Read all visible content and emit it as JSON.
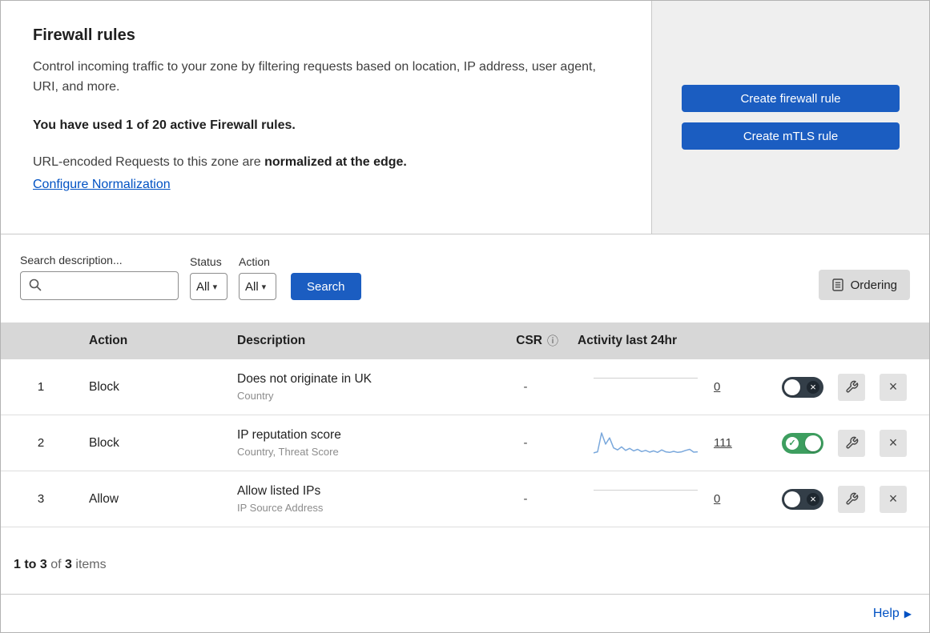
{
  "header": {
    "title": "Firewall rules",
    "description": "Control incoming traffic to your zone by filtering requests based on location, IP address, user agent, URI, and more.",
    "usage_notice": "You have used 1 of 20 active Firewall rules.",
    "normalization_text": "URL-encoded Requests to this zone are ",
    "normalization_bold": "normalized at the edge.",
    "normalization_link": "Configure Normalization",
    "create_firewall_rule_label": "Create firewall rule",
    "create_mtls_rule_label": "Create mTLS rule"
  },
  "filters": {
    "search_label": "Search description...",
    "status_label": "Status",
    "status_value": "All",
    "action_label": "Action",
    "action_value": "All",
    "search_button_label": "Search",
    "ordering_button_label": "Ordering"
  },
  "table": {
    "headers": {
      "action": "Action",
      "description": "Description",
      "csr": "CSR",
      "activity": "Activity last 24hr"
    },
    "rows": [
      {
        "number": "1",
        "action": "Block",
        "description": "Does not originate in UK",
        "match": "Country",
        "csr": "-",
        "activity_count": "0",
        "enabled": false
      },
      {
        "number": "2",
        "action": "Block",
        "description": "IP reputation score",
        "match": "Country, Threat Score",
        "csr": "-",
        "activity_count": "111",
        "enabled": true
      },
      {
        "number": "3",
        "action": "Allow",
        "description": "Allow listed IPs",
        "match": "IP Source Address",
        "csr": "-",
        "activity_count": "0",
        "enabled": false
      }
    ]
  },
  "chart_data": {
    "type": "line",
    "title": "Activity last 24hr sparkline (rule 2)",
    "values": [
      10,
      14,
      90,
      45,
      70,
      30,
      22,
      34,
      20,
      28,
      18,
      24,
      15,
      20,
      13,
      18,
      12,
      22,
      14,
      12,
      16,
      12,
      14,
      20,
      24,
      13,
      14
    ],
    "color": "#7aa8dc"
  },
  "footer": {
    "range": "1 to 3",
    "of_text": "of",
    "total": "3",
    "items_text": "items",
    "help_label": "Help"
  },
  "icons": {
    "search": "magnifier",
    "dropdown": "caret-down",
    "ordering": "list-document",
    "info": "info-circle",
    "toggle_on": "check",
    "toggle_off": "cross",
    "edit": "wrench",
    "delete": "x"
  },
  "colors": {
    "primary_blue": "#1b5dc1",
    "link_blue": "#0051c3",
    "toggle_on_green": "#3d9e5f",
    "toggle_off_dark": "#333e48",
    "table_header_gray": "#d7d7d7",
    "panel_gray": "#efefef",
    "sparkline_blue": "#7aa8dc"
  }
}
